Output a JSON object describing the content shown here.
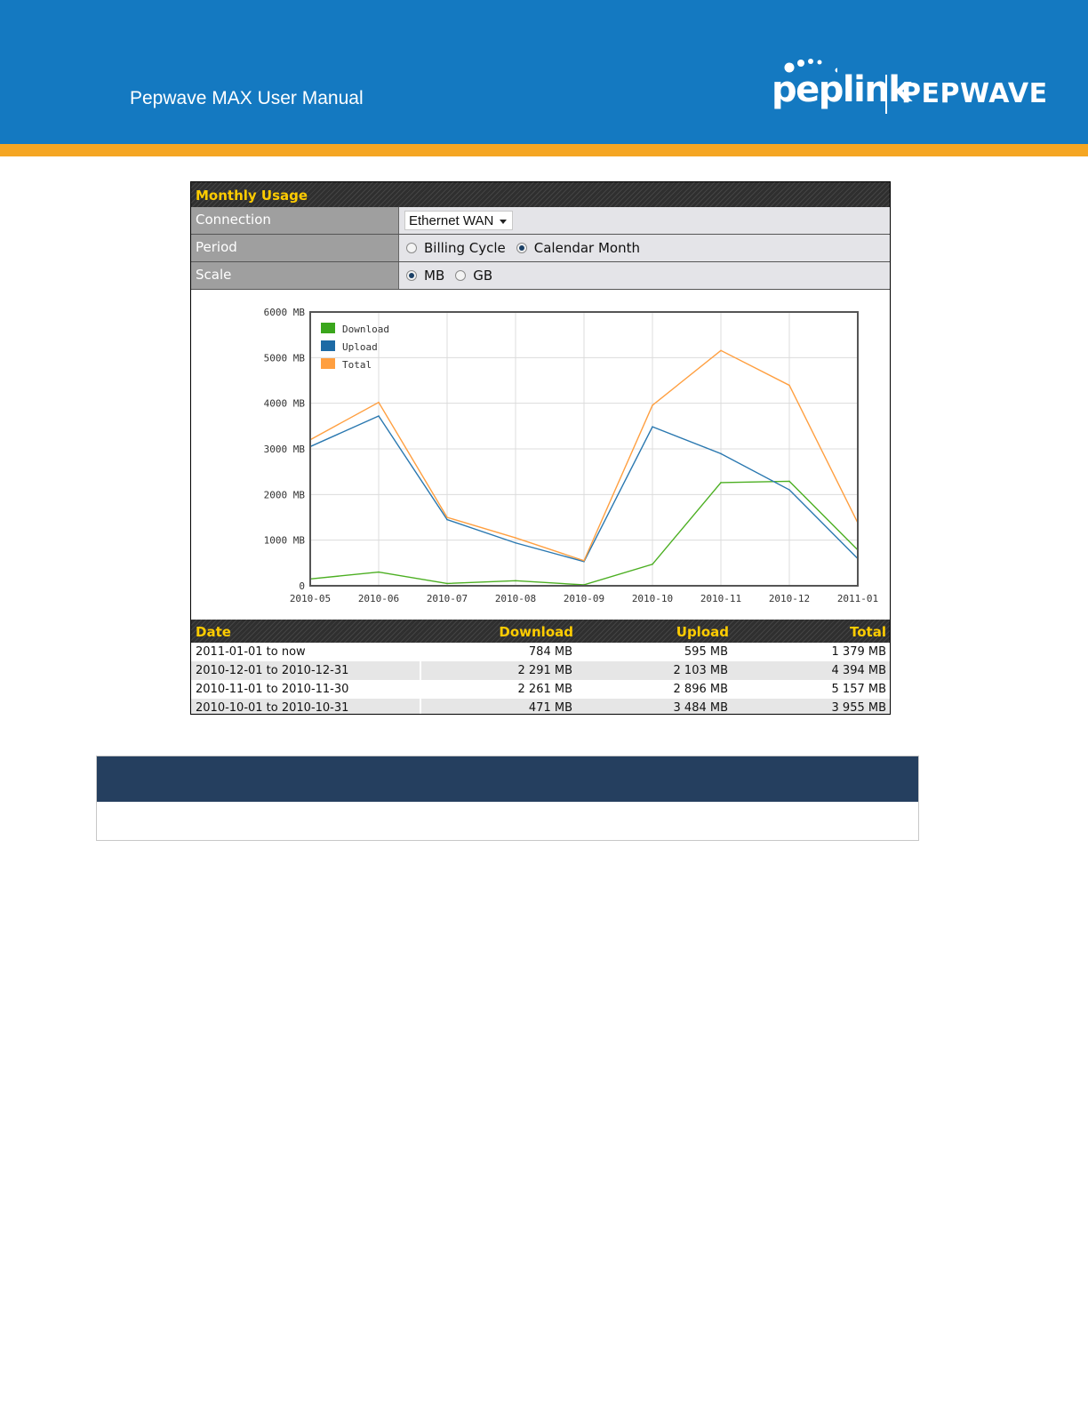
{
  "header": {
    "manual_title": "Pepwave MAX User Manual",
    "logo_left": "peplink",
    "logo_right": "PEPWAVE"
  },
  "panel": {
    "title": "Monthly Usage",
    "connection": {
      "label": "Connection",
      "selected": "Ethernet WAN"
    },
    "period": {
      "label": "Period",
      "options": [
        "Billing Cycle",
        "Calendar Month"
      ],
      "selected_index": 1
    },
    "scale": {
      "label": "Scale",
      "options": [
        "MB",
        "GB"
      ],
      "selected_index": 0
    }
  },
  "chart_data": {
    "type": "line",
    "x": [
      "2010-05",
      "2010-06",
      "2010-07",
      "2010-08",
      "2010-09",
      "2010-10",
      "2010-11",
      "2010-12",
      "2011-01"
    ],
    "series": [
      {
        "name": "Download",
        "color": "#4caf22",
        "values": [
          150,
          300,
          50,
          110,
          20,
          471,
          2261,
          2291,
          784
        ]
      },
      {
        "name": "Upload",
        "color": "#2a78b0",
        "values": [
          3050,
          3720,
          1450,
          940,
          530,
          3484,
          2896,
          2103,
          595
        ]
      },
      {
        "name": "Total",
        "color": "#ff9f40",
        "values": [
          3200,
          4020,
          1500,
          1050,
          550,
          3955,
          5157,
          4394,
          1379
        ]
      }
    ],
    "y_ticks": [
      "0",
      "1000 MB",
      "2000 MB",
      "3000 MB",
      "4000 MB",
      "5000 MB",
      "6000 MB"
    ],
    "y_tick_values": [
      0,
      1000,
      2000,
      3000,
      4000,
      5000,
      6000
    ],
    "ylim": [
      0,
      6000
    ],
    "grid": true,
    "legend_position": "top-left",
    "legend_swatch_colors": {
      "Download": "#3aa61c",
      "Upload": "#1d6aa5",
      "Total": "#ff9f40"
    }
  },
  "usage_table": {
    "headers": [
      "Date",
      "Download",
      "Upload",
      "Total"
    ],
    "rows": [
      [
        "2011-01-01 to now",
        "784 MB",
        "595 MB",
        "1 379 MB"
      ],
      [
        "2010-12-01 to 2010-12-31",
        "2 291 MB",
        "2 103 MB",
        "4 394 MB"
      ],
      [
        "2010-11-01 to 2010-11-30",
        "2 261 MB",
        "2 896 MB",
        "5 157 MB"
      ],
      [
        "2010-10-01 to 2010-10-31",
        "471 MB",
        "3 484 MB",
        "3 955 MB"
      ]
    ]
  },
  "colors": {
    "banner": "#1479c1",
    "banner_stripe": "#f5a623",
    "panel_header_text": "#ffcc00",
    "callout_header": "#253f5f"
  }
}
